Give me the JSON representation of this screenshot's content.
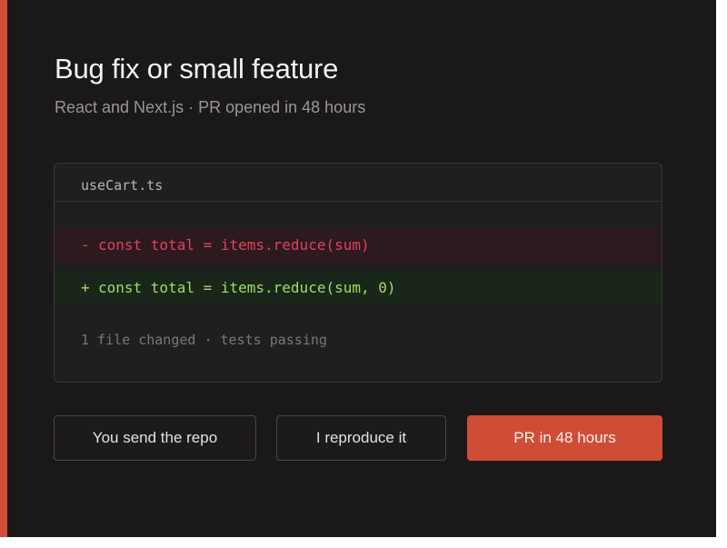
{
  "header": {
    "title": "Bug fix or small feature",
    "subtitle": "React and Next.js · PR opened in 48 hours"
  },
  "code_panel": {
    "filename": "useCart.ts",
    "removed_sign": "-",
    "removed_line": "const total = items.reduce(sum)",
    "added_sign": "+",
    "added_line": "const total = items.reduce(sum, 0)",
    "summary": "1 file changed · tests passing"
  },
  "steps": [
    {
      "label": "You send the repo"
    },
    {
      "label": "I reproduce it"
    },
    {
      "label": "PR in 48 hours"
    }
  ],
  "colors": {
    "accent": "#d04e38",
    "background": "#1a1819",
    "removed_text": "#e4405e",
    "added_text": "#9fdc6a"
  }
}
